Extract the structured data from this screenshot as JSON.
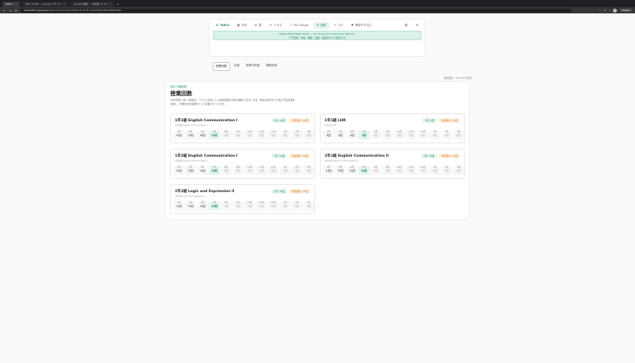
{
  "browser": {
    "tabs": [
      {
        "label": "Tofinn",
        "active": true
      },
      {
        "label": "Wey Chi-Mi — Google スライド",
        "active": false
      },
      {
        "label": "Google 翻訳 — 日本語 (3 / 5)",
        "active": false
      }
    ],
    "url_host": "www.tofinn-kyoiku.jp",
    "url_path": "/lessoncount?code=2025 4F 1475 7AG97486 GIRGH8RKIG0M",
    "pause_label": "Pause"
  },
  "nav": {
    "items": [
      {
        "icon": "tree-logo-icon",
        "label": "Tofinn",
        "logo": true
      },
      {
        "icon": "calendar-icon",
        "label": "今日"
      },
      {
        "icon": "grid-icon",
        "label": "週"
      },
      {
        "icon": "people-icon",
        "label": "クラス"
      },
      {
        "icon": "group-icon",
        "label": "My Groups"
      },
      {
        "icon": "list-icon",
        "label": "記録",
        "active": true
      },
      {
        "icon": "memo-icon",
        "label": "メモ"
      },
      {
        "icon": "heart-icon",
        "label": "帰宅PTもなし"
      }
    ],
    "banner_line1": "Openai Build Week Demo — All names and records are fictional.",
    "banner_line2": "デモ環境：学校・職員・生徒・記録はすべて架空です"
  },
  "subtabs": [
    {
      "label": "授業回数",
      "active": true
    },
    {
      "label": "出席"
    },
    {
      "label": "授業内評価"
    },
    {
      "label": "課題評価"
    }
  ],
  "note": "最終更新：2025年7月集計",
  "page": {
    "breadcrumb": "記録 / 授業回数",
    "title": "授業回数",
    "desc_line1": "2026年度 4月〜3月時点。クラス×科目ごとの実施回数を月別の推移で表示します。現在は休日計上を含む予定変更を",
    "desc_line2": "反映し、月単位を年度累計として記載されています。"
  },
  "months": [
    "4月",
    "5月",
    "6月",
    "7月",
    "8月",
    "9月",
    "10月",
    "11月",
    "12月",
    "1月",
    "2月",
    "3月"
  ],
  "cards": [
    {
      "title": "1年1組 English Communication I",
      "sub": "1年1組 English Communication I",
      "month_badge": "7月: 12回",
      "total_badge": "年度累計: 68回",
      "values": [
        "11回",
        "13回",
        "16回",
        "12回",
        "0回",
        "0回",
        "0回",
        "0回",
        "0回",
        "0回",
        "0回",
        "0回"
      ]
    },
    {
      "title": "1年1組 LHR",
      "sub": "1年1組 LHR",
      "month_badge": "7月: 3回",
      "total_badge": "年度累計: 16回",
      "values": [
        "5回",
        "4回",
        "4回",
        "3回",
        "0回",
        "0回",
        "0回",
        "0回",
        "0回",
        "0回",
        "0回",
        "0回"
      ]
    },
    {
      "title": "1年2組 English Communication I",
      "sub": "1年2組 English Communication I",
      "month_badge": "7月: 10回",
      "total_badge": "年度累計: 48回",
      "values": [
        "12回",
        "12回",
        "14回",
        "10回",
        "0回",
        "0回",
        "0回",
        "0回",
        "0回",
        "0回",
        "0回",
        "0回"
      ]
    },
    {
      "title": "2年1組 English Communication II",
      "sub": "2年1組 English Communication II",
      "month_badge": "7月: 10回",
      "total_badge": "年度累計: 48回",
      "values": [
        "14回",
        "12回",
        "12回",
        "10回",
        "0回",
        "0回",
        "0回",
        "0回",
        "0回",
        "0回",
        "0回",
        "0回"
      ]
    },
    {
      "title": "2年2組 Logic and Expression II",
      "sub": "2年2組 Logic and Expression II",
      "month_badge": "7月: 10回",
      "total_badge": "年度累計: 48回",
      "values": [
        "12回",
        "12回",
        "14回",
        "10回",
        "0回",
        "0回",
        "0回",
        "0回",
        "0回",
        "0回",
        "0回",
        "0回"
      ]
    }
  ],
  "current_month_index": 3
}
